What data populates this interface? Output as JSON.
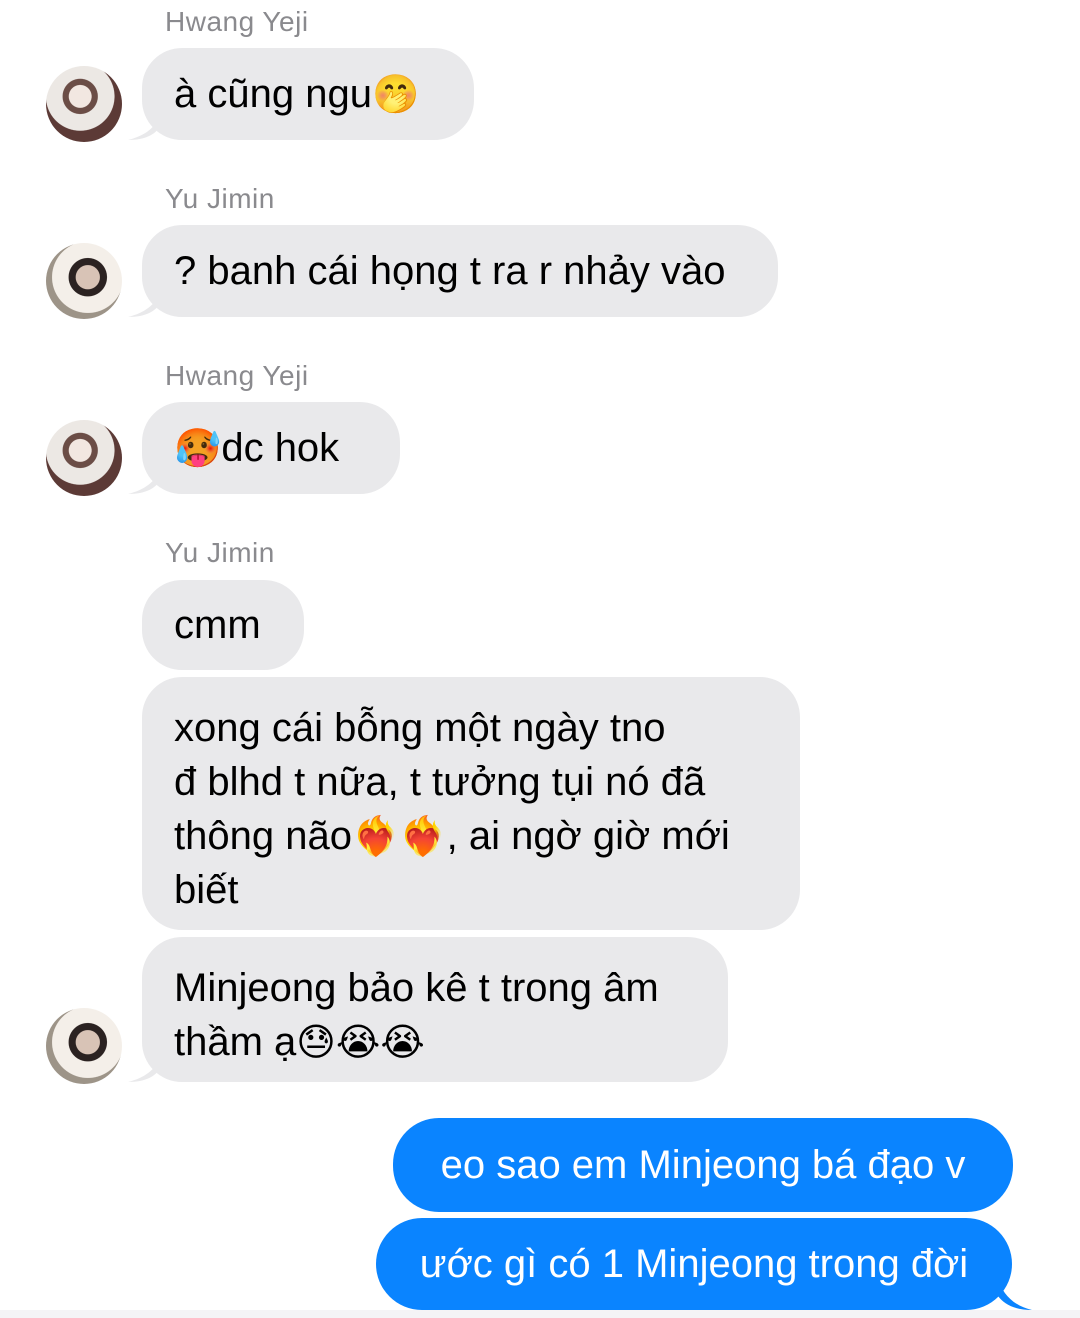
{
  "messages": [
    {
      "sender": "Hwang Yeji",
      "text": "à cũng ngu",
      "emoji": "🤭"
    },
    {
      "sender": "Yu Jimin",
      "text": "? banh cái họng t ra r nhảy vào"
    },
    {
      "sender": "Hwang Yeji",
      "emoji": "🥵",
      "text": " dc hok"
    },
    {
      "sender": "Yu Jimin",
      "text": "cmm"
    },
    {
      "lines": [
        "xong cái bỗng một ngày tno",
        "đ blhd t nữa, t tưởng tụi nó đã",
        "thông não",
        ", ai ngờ giờ mới",
        "biết"
      ],
      "emoji": "❤️‍🔥❤️‍🔥"
    },
    {
      "lines": [
        "Minjeong bảo kê t trong âm",
        "thầm ạ"
      ],
      "emoji": "😓😭😭"
    }
  ],
  "outgoing": [
    {
      "text": "eo sao em Minjeong bá đạo v"
    },
    {
      "text": "ước gì có 1 Minjeong trong đời"
    }
  ]
}
